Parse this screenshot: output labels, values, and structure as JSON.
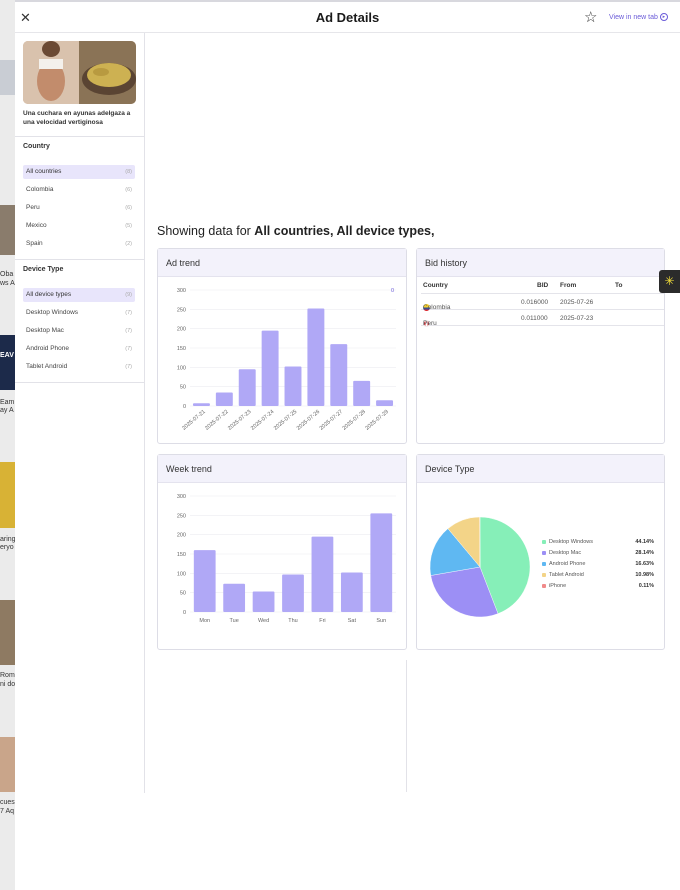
{
  "header": {
    "title": "Ad Details",
    "close_icon": "close-icon",
    "star_icon": "star-icon",
    "open_new_tab": "View in new tab"
  },
  "ad": {
    "caption": "Una cuchara en ayunas adelgaza a una velocidad vertiginosa"
  },
  "filters": {
    "country_title": "Country",
    "countries": [
      {
        "label": "All countries",
        "count": "(8)"
      },
      {
        "label": "Colombia",
        "count": "(6)"
      },
      {
        "label": "Peru",
        "count": "(6)"
      },
      {
        "label": "Mexico",
        "count": "(5)"
      },
      {
        "label": "Spain",
        "count": "(2)"
      }
    ],
    "device_title": "Device Type",
    "devices": [
      {
        "label": "All device types",
        "count": "(9)"
      },
      {
        "label": "Desktop Windows",
        "count": "(7)"
      },
      {
        "label": "Desktop Mac",
        "count": "(7)"
      },
      {
        "label": "Android Phone",
        "count": "(7)"
      },
      {
        "label": "Tablet Android",
        "count": "(7)"
      }
    ]
  },
  "showing": {
    "prefix": "Showing data for ",
    "value": "All countries, All device types,"
  },
  "cards": {
    "ad_trend": "Ad trend",
    "bid_history": "Bid history",
    "week_trend": "Week trend",
    "device_type": "Device Type"
  },
  "bid_history": {
    "headers": [
      "Country",
      "BID",
      "From",
      "To"
    ],
    "rows": [
      {
        "country": "Colombia",
        "bid": "0.016000",
        "from": "2025-07-26",
        "to": ""
      },
      {
        "country": "Peru",
        "bid": "0.011000",
        "from": "2025-07-23",
        "to": ""
      }
    ]
  },
  "background_page": {
    "snippets": [
      "Oba",
      "ws A",
      "EAV",
      "Eam",
      "ay A",
      "aring",
      "eryo",
      "Rom",
      "ni do",
      "cues",
      "7 Aq"
    ]
  },
  "colors": {
    "accent": "#6a5bd8",
    "bar": "#b0a8f6",
    "card_header": "#f3f2fb",
    "selected_filter": "#e8e5fb"
  },
  "chart_data": [
    {
      "type": "bar",
      "title": "Ad trend",
      "categories": [
        "2025-07-21",
        "2025-07-22",
        "2025-07-23",
        "2025-07-24",
        "2025-07-25",
        "2025-07-26",
        "2025-07-27",
        "2025-07-28",
        "2025-07-29"
      ],
      "values": [
        7,
        35,
        95,
        195,
        102,
        252,
        160,
        65,
        15
      ],
      "ylim": [
        0,
        300
      ],
      "yticks": [
        0,
        50,
        100,
        150,
        200,
        250,
        300
      ],
      "legend_marker": "0",
      "grid": true
    },
    {
      "type": "bar",
      "title": "Week trend",
      "categories": [
        "Mon",
        "Tue",
        "Wed",
        "Thu",
        "Fri",
        "Sat",
        "Sun"
      ],
      "values": [
        160,
        73,
        53,
        97,
        195,
        102,
        255
      ],
      "ylim": [
        0,
        300
      ],
      "yticks": [
        0,
        50,
        100,
        150,
        200,
        250,
        300
      ],
      "grid": true
    },
    {
      "type": "pie",
      "title": "Device Type",
      "slices": [
        {
          "label": "Desktop Windows",
          "value": 44.14,
          "display": "44.14%",
          "color": "#86efb8"
        },
        {
          "label": "Desktop Mac",
          "value": 28.14,
          "display": "28.14%",
          "color": "#9c8ff5"
        },
        {
          "label": "Android Phone",
          "value": 16.63,
          "display": "16.63%",
          "color": "#5fb8f2"
        },
        {
          "label": "Tablet Android",
          "value": 10.98,
          "display": "10.98%",
          "color": "#f3d488"
        },
        {
          "label": "iPhone",
          "value": 0.11,
          "display": "0.11%",
          "color": "#f08a8a"
        }
      ],
      "legend": "right"
    }
  ]
}
